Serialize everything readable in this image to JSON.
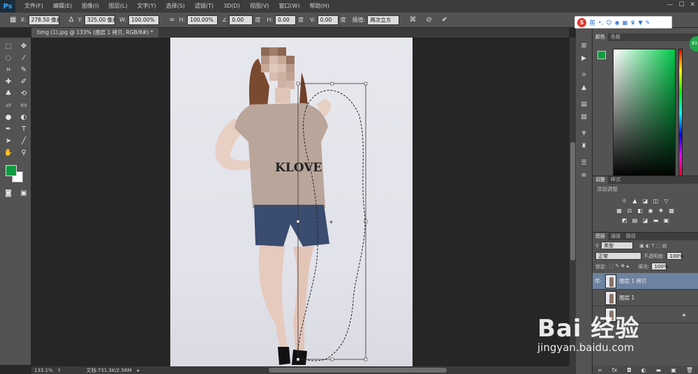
{
  "app": {
    "logo": "Ps"
  },
  "menubar": {
    "items": [
      "文件(F)",
      "编辑(E)",
      "图像(I)",
      "图层(L)",
      "文字(Y)",
      "选择(S)",
      "滤镜(T)",
      "3D(D)",
      "视图(V)",
      "窗口(W)",
      "帮助(H)"
    ]
  },
  "options": {
    "x_label": "X:",
    "x_value": "278.50 像素",
    "y_label": "Y:",
    "y_value": "325.00 像素",
    "w_label": "W:",
    "w_value": "100.00%",
    "h_label": "H:",
    "h_value": "100.00%",
    "angle_value": "0.00",
    "angle_unit": "度",
    "hskew_label": "H:",
    "hskew_value": "0.00",
    "hskew_unit": "度",
    "vskew_label": "V:",
    "vskew_value": "0.00",
    "vskew_unit": "度",
    "interp_label": "插值:",
    "interp_value": "两次立方"
  },
  "document": {
    "tab_title": "timg (1).jpg @ 133% (图层 1 拷贝, RGB/8#) *"
  },
  "status": {
    "zoom": "133.1%",
    "doc_info": "文档:731.3K/2.56M"
  },
  "color_panel": {
    "tabs": [
      "颜色",
      "色板"
    ],
    "fg_color": "#0f9b3e",
    "bg_color": "#ffffff"
  },
  "adjust_panel": {
    "tabs": [
      "调整",
      "样式"
    ],
    "title": "添加调整"
  },
  "layers_panel": {
    "tabs": [
      "图层",
      "通道",
      "路径"
    ],
    "filter_kind": "类型",
    "blend_mode": "正常",
    "opacity_label": "不透明度:",
    "opacity_value": "100%",
    "lock_label": "锁定:",
    "fill_label": "填充:",
    "fill_value": "100%",
    "layers": [
      {
        "name": "图层 1 拷贝",
        "selected": true
      },
      {
        "name": "图层 1",
        "selected": false
      }
    ]
  },
  "ime": {
    "logo": "S",
    "lang": "英"
  },
  "badge": {
    "text": "83"
  },
  "watermark": {
    "logo": "Bai 经验",
    "url": "jingyan.baidu.com"
  }
}
